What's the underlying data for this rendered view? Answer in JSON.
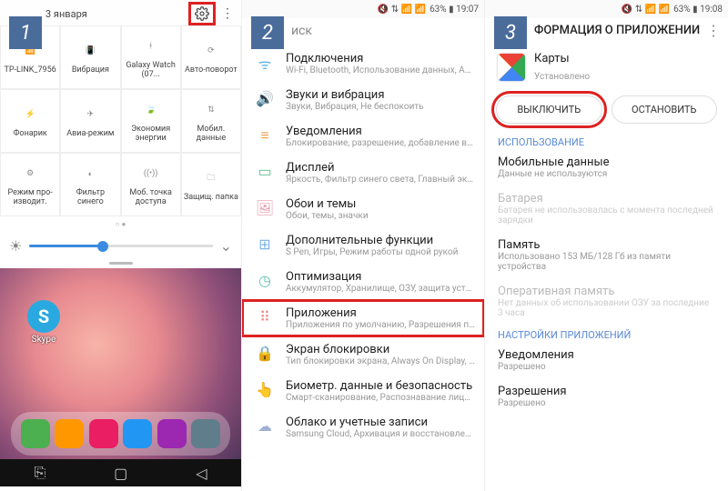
{
  "step_numbers": [
    "1",
    "2",
    "3"
  ],
  "panel1": {
    "date": "3 января",
    "gear_icon": "settings",
    "tiles": [
      {
        "icon": "wifi",
        "label": "TP-LINK_7956"
      },
      {
        "icon": "vibrate",
        "label": "Вибрация"
      },
      {
        "icon": "bt",
        "label": "Galaxy Watch (07..."
      },
      {
        "icon": "rotate",
        "label": "Авто-поворот"
      },
      {
        "icon": "flash",
        "label": "Фонарик"
      },
      {
        "icon": "plane",
        "label": "Авиа-режим"
      },
      {
        "icon": "leaf",
        "label": "Экономия энергии"
      },
      {
        "icon": "data",
        "label": "Мобил. данные"
      },
      {
        "icon": "perf",
        "label": "Режим про-изводит."
      },
      {
        "icon": "blue",
        "label": "Фильтр синего"
      },
      {
        "icon": "hotspot",
        "label": "Моб. точка доступа"
      },
      {
        "icon": "folder",
        "label": "Защищ. папка"
      }
    ],
    "skype_label": "Skype"
  },
  "panel2": {
    "status_text": "63% ▮ 19:07",
    "search_placeholder": "иск",
    "rows": [
      {
        "icon": "conn",
        "title": "Подключения",
        "sub": "Wi-Fi, Bluetooth, Использование данных, Ави..."
      },
      {
        "icon": "sound",
        "title": "Звуки и вибрация",
        "sub": "Звуки, Вибрация, Не беспокоить"
      },
      {
        "icon": "notif",
        "title": "Уведомления",
        "sub": "Блокирование, разрешение, добавление в п..."
      },
      {
        "icon": "display",
        "title": "Дисплей",
        "sub": "Яркость, Фильтр синего света, Главный экр..."
      },
      {
        "icon": "wall",
        "title": "Обои и темы",
        "sub": "Обои, темы, значки"
      },
      {
        "icon": "adv",
        "title": "Дополнительные функции",
        "sub": "S Pen, Игры, Режим работы одной рукой"
      },
      {
        "icon": "opt",
        "title": "Оптимизация",
        "sub": "Аккумулятор, Хранилище, ОЗУ, защита устро..."
      },
      {
        "icon": "apps",
        "title": "Приложения",
        "sub": "Приложения по умолчанию, Разрешения пр...",
        "highlight": true
      },
      {
        "icon": "lock",
        "title": "Экран блокировки",
        "sub": "Тип блокировки экрана, Always On Display, С..."
      },
      {
        "icon": "bio",
        "title": "Биометр. данные и безопасность",
        "sub": "Смарт-сканирование, Распознавание лица..."
      },
      {
        "icon": "cloud",
        "title": "Облако и учетные записи",
        "sub": "Samsung Cloud, Архивация и восстановление..."
      }
    ]
  },
  "panel3": {
    "status_text": "63% ▮ 19:08",
    "header": "ФОРМАЦИЯ О ПРИЛОЖЕНИИ",
    "app_name": "Карты",
    "app_status": "Установлено",
    "btn_disable": "ВЫКЛЮЧИТЬ",
    "btn_stop": "ОСТАНОВИТЬ",
    "sect_usage": "ИСПОЛЬЗОВАНИЕ",
    "rows_usage": [
      {
        "t": "Мобильные данные",
        "s": "Данные не используются"
      },
      {
        "t": "Батарея",
        "s": "Батарея не использовалась с момента последней зарядки",
        "dim": true
      },
      {
        "t": "Память",
        "s": "Использовано 153 МБ/128 Гб из памяти устройства"
      },
      {
        "t": "Оперативная память",
        "s": "Нет данных об использовании ОЗУ за последние 3 часа",
        "dim": true
      }
    ],
    "sect_settings": "НАСТРОЙКИ ПРИЛОЖЕНИЙ",
    "rows_settings": [
      {
        "t": "Уведомления",
        "s": "Разрешено"
      },
      {
        "t": "Разрешения",
        "s": "Разрешено"
      }
    ]
  }
}
